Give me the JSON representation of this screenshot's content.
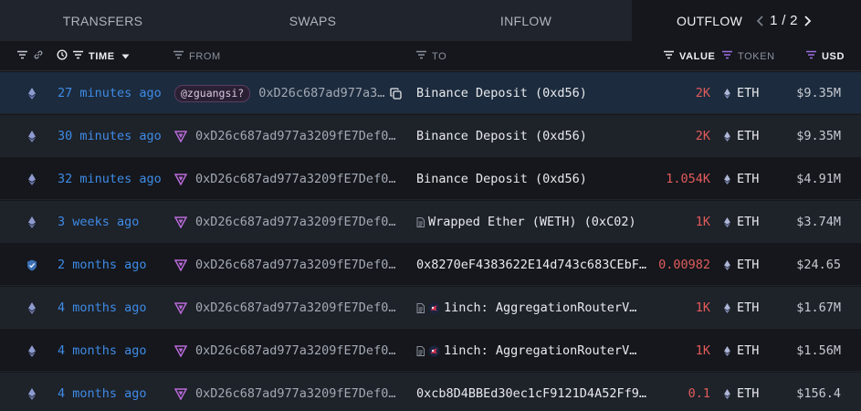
{
  "tabs": [
    {
      "label": "TRANSFERS"
    },
    {
      "label": "SWAPS"
    },
    {
      "label": "INFLOW"
    },
    {
      "label": "OUTFLOW"
    }
  ],
  "pager": {
    "text": "1 / 2"
  },
  "columns": {
    "time": "TIME",
    "from": "FROM",
    "to": "TO",
    "value": "VALUE",
    "token": "TOKEN",
    "usd": "USD"
  },
  "rows": [
    {
      "time": "27 minutes ago",
      "from_tag": "@zguangsi?",
      "from": "0xD26c687ad977a3…",
      "to": "Binance Deposit (0xd56)",
      "value": "2K",
      "token": "ETH",
      "usd": "$9.35M"
    },
    {
      "time": "30 minutes ago",
      "from": "0xD26c687ad977a3209fE7Def0…",
      "to": "Binance Deposit (0xd56)",
      "value": "2K",
      "token": "ETH",
      "usd": "$9.35M"
    },
    {
      "time": "32 minutes ago",
      "from": "0xD26c687ad977a3209fE7Def0…",
      "to": "Binance Deposit (0xd56)",
      "value": "1.054K",
      "token": "ETH",
      "usd": "$4.91M"
    },
    {
      "time": "3 weeks ago",
      "from": "0xD26c687ad977a3209fE7Def0…",
      "to": "Wrapped Ether (WETH) (0xC02)",
      "value": "1K",
      "token": "ETH",
      "usd": "$3.74M"
    },
    {
      "time": "2 months ago",
      "from": "0xD26c687ad977a3209fE7Def0…",
      "to": "0x8270eF4383622E14d743c683CEbF…",
      "value": "0.00982",
      "token": "ETH",
      "usd": "$24.65"
    },
    {
      "time": "4 months ago",
      "from": "0xD26c687ad977a3209fE7Def0…",
      "to": "1inch: AggregationRouterV…",
      "value": "1K",
      "token": "ETH",
      "usd": "$1.67M"
    },
    {
      "time": "4 months ago",
      "from": "0xD26c687ad977a3209fE7Def0…",
      "to": "1inch: AggregationRouterV…",
      "value": "1K",
      "token": "ETH",
      "usd": "$1.56M"
    },
    {
      "time": "4 months ago",
      "from": "0xD26c687ad977a3209fE7Def0…",
      "to": "0xcb8D4BBEd30ec1cF9121D4A52Ff9…",
      "value": "0.1",
      "token": "ETH",
      "usd": "$156.4"
    }
  ],
  "colors": {
    "time_link": "#3e8be6",
    "value_red": "#e25b5b",
    "selected_row": "#1c2b3d",
    "tag_purple": "#b86ad8"
  },
  "icons": {
    "chain": "ethereum-icon",
    "from_entity": "arkham-entity-icon",
    "contract": "contract-icon",
    "oneinch": "1inch-logo-icon",
    "copy": "copy-icon"
  }
}
